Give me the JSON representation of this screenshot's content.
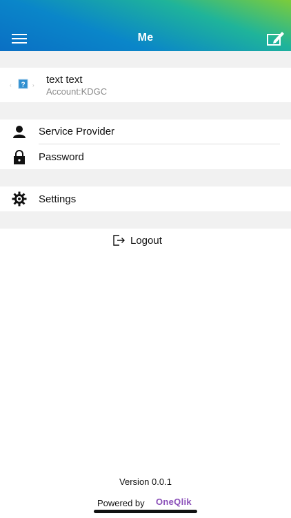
{
  "header": {
    "title": "Me",
    "menu_icon": "hamburger-menu-icon",
    "edit_icon": "edit-note-icon",
    "gradient_colors": [
      "#7ccc3a",
      "#1fb49a",
      "#0a86c9",
      "#0a6fc4"
    ]
  },
  "profile": {
    "name": "text text",
    "account": "Account:KDGC",
    "avatar_icon": "question-avatar-icon"
  },
  "menu": {
    "service_provider": {
      "label": "Service Provider",
      "icon": "person-icon"
    },
    "password": {
      "label": "Password",
      "icon": "lock-icon"
    },
    "settings": {
      "label": "Settings",
      "icon": "gear-icon"
    }
  },
  "logout": {
    "label": "Logout",
    "icon": "logout-icon"
  },
  "footer": {
    "version": "Version 0.0.1",
    "powered_by": "Powered by",
    "brand": "OneQlik",
    "brand_color": "#8a4fb8"
  }
}
